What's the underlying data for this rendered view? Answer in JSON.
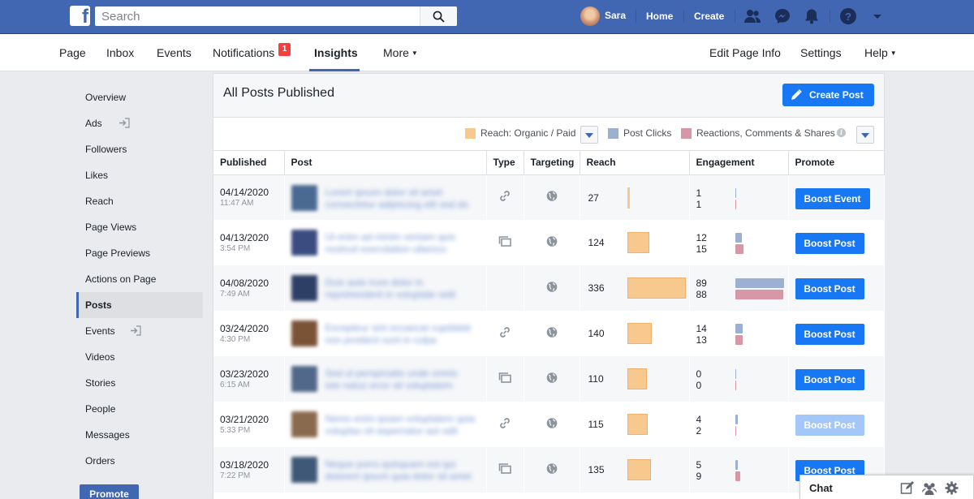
{
  "topbar": {
    "search_placeholder": "Search",
    "user_name": "Sara",
    "home": "Home",
    "create": "Create",
    "icons": [
      "friends-icon",
      "messenger-icon",
      "notifications-bell-icon",
      "help-icon",
      "account-menu-caret-icon"
    ],
    "color": "#4267b2"
  },
  "subnav": {
    "left": [
      {
        "label": "Page"
      },
      {
        "label": "Inbox"
      },
      {
        "label": "Events"
      },
      {
        "label": "Notifications",
        "badge": "1"
      },
      {
        "label": "Insights",
        "active": true
      },
      {
        "label": "More"
      }
    ],
    "right": [
      {
        "label": "Edit Page Info"
      },
      {
        "label": "Settings"
      },
      {
        "label": "Help"
      }
    ]
  },
  "sidebar": {
    "items": [
      {
        "label": "Overview"
      },
      {
        "label": "Ads",
        "icon": "external-link-icon"
      },
      {
        "label": "Followers"
      },
      {
        "label": "Likes"
      },
      {
        "label": "Reach"
      },
      {
        "label": "Page Views"
      },
      {
        "label": "Page Previews"
      },
      {
        "label": "Actions on Page"
      },
      {
        "label": "Posts",
        "active": true
      },
      {
        "label": "Events",
        "icon": "external-link-icon"
      },
      {
        "label": "Videos"
      },
      {
        "label": "Stories"
      },
      {
        "label": "People"
      },
      {
        "label": "Messages"
      },
      {
        "label": "Orders"
      }
    ],
    "promote": "Promote"
  },
  "panel": {
    "title": "All Posts Published",
    "create_post": "Create Post",
    "legend": {
      "reach": "Reach: Organic / Paid",
      "clicks": "Post Clicks",
      "reactions": "Reactions, Comments & Shares",
      "reach_color": "#f7c98f",
      "clicks_color": "#9cb0d2",
      "reactions_color": "#d797a7"
    },
    "columns": [
      "Published",
      "Post",
      "Type",
      "Targeting",
      "Reach",
      "Engagement",
      "Promote"
    ],
    "rows": [
      {
        "date": "04/14/2020",
        "time": "11:47 AM",
        "post": "Lorem ipsum dolor sit amet consectetur adipiscing elit sed do eiusmod",
        "type": "link-icon",
        "reach": 27,
        "clicks": 1,
        "reactions": 1,
        "boost": "Boost Event",
        "thumb": "#4a6a92"
      },
      {
        "date": "04/13/2020",
        "time": "3:54 PM",
        "post": "Ut enim ad minim veniam quis nostrud exercitation ullamco laboris",
        "type": "album-icon",
        "reach": 124,
        "clicks": 12,
        "reactions": 15,
        "boost": "Boost Post",
        "thumb": "#3b4c80"
      },
      {
        "date": "04/08/2020",
        "time": "7:49 AM",
        "post": "Duis aute irure dolor in reprehenderit in voluptate velit esse",
        "type": "",
        "reach": 336,
        "clicks": 89,
        "reactions": 88,
        "boost": "Boost Post",
        "thumb": "#2e3f66"
      },
      {
        "date": "03/24/2020",
        "time": "4:30 PM",
        "post": "Excepteur sint occaecat cupidatat non proident sunt in culpa",
        "type": "link-icon",
        "reach": 140,
        "clicks": 14,
        "reactions": 13,
        "boost": "Boost Post",
        "thumb": "#7a5236"
      },
      {
        "date": "03/23/2020",
        "time": "6:15 AM",
        "post": "Sed ut perspiciatis unde omnis iste natus error sit voluptatem",
        "type": "album-icon",
        "reach": 110,
        "clicks": 0,
        "reactions": 0,
        "boost": "Boost Post",
        "thumb": "#52688a"
      },
      {
        "date": "03/21/2020",
        "time": "5:33 PM",
        "post": "Nemo enim ipsam voluptatem quia voluptas sit aspernatur aut odit",
        "type": "link-icon",
        "reach": 115,
        "clicks": 4,
        "reactions": 2,
        "boost": "Boost Post",
        "thumb": "#8a6a4e",
        "disabled": true
      },
      {
        "date": "03/18/2020",
        "time": "7:22 PM",
        "post": "Neque porro quisquam est qui dolorem ipsum quia dolor sit amet",
        "type": "album-icon",
        "reach": 135,
        "clicks": 5,
        "reactions": 9,
        "boost": "Boost Post",
        "thumb": "#3f5878"
      }
    ]
  },
  "chat": {
    "label": "Chat"
  }
}
